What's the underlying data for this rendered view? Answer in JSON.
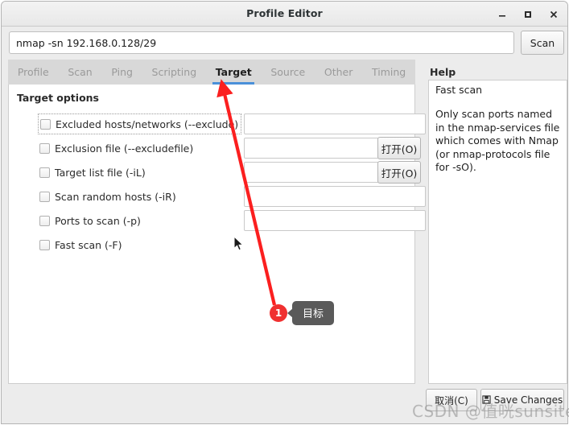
{
  "window": {
    "title": "Profile Editor",
    "controls": {
      "minimize": "minimize-icon",
      "maximize": "maximize-icon",
      "close": "close-icon"
    }
  },
  "command_bar": {
    "value": "nmap -sn 192.168.0.128/29",
    "placeholder": "",
    "scan_label": "Scan"
  },
  "tabs": [
    {
      "label": "Profile",
      "active": false
    },
    {
      "label": "Scan",
      "active": false
    },
    {
      "label": "Ping",
      "active": false
    },
    {
      "label": "Scripting",
      "active": false
    },
    {
      "label": "Target",
      "active": true
    },
    {
      "label": "Source",
      "active": false
    },
    {
      "label": "Other",
      "active": false
    },
    {
      "label": "Timing",
      "active": false
    }
  ],
  "target_panel": {
    "section_title": "Target options",
    "options": [
      {
        "label": "Excluded hosts/networks (--exclude)",
        "checked": false,
        "focused": true,
        "field_value": "",
        "field_width": "wide",
        "open_button": null
      },
      {
        "label": "Exclusion file (--excludefile)",
        "checked": false,
        "focused": false,
        "field_value": "",
        "field_width": "narrow",
        "open_button": "打开(O)"
      },
      {
        "label": "Target list file (-iL)",
        "checked": false,
        "focused": false,
        "field_value": "",
        "field_width": "narrow",
        "open_button": "打开(O)"
      },
      {
        "label": "Scan random hosts (-iR)",
        "checked": false,
        "focused": false,
        "field_value": "",
        "field_width": "wide",
        "open_button": null
      },
      {
        "label": "Ports to scan (-p)",
        "checked": false,
        "focused": false,
        "field_value": "",
        "field_width": "wide",
        "open_button": null
      },
      {
        "label": "Fast scan (-F)",
        "checked": false,
        "focused": false,
        "field_value": null,
        "field_width": null,
        "open_button": null
      }
    ]
  },
  "help": {
    "title": "Help",
    "heading": "Fast scan",
    "body": "Only scan ports named in the nmap-services file which comes with Nmap (or nmap-protocols file for -sO)."
  },
  "footer": {
    "cancel_label": "取消(C)",
    "save_label": "Save Changes",
    "save_icon": "save-icon"
  },
  "annotation": {
    "number": "1",
    "text": "目标",
    "arrow_color": "#fb1f1f"
  },
  "watermark": {
    "text": "CSDN @值咣sunsite"
  },
  "colors": {
    "accent": "#4a90d9",
    "annotation_red": "#f03030",
    "tab_bar": "#d8d8d8",
    "window_bg": "#ececec"
  }
}
